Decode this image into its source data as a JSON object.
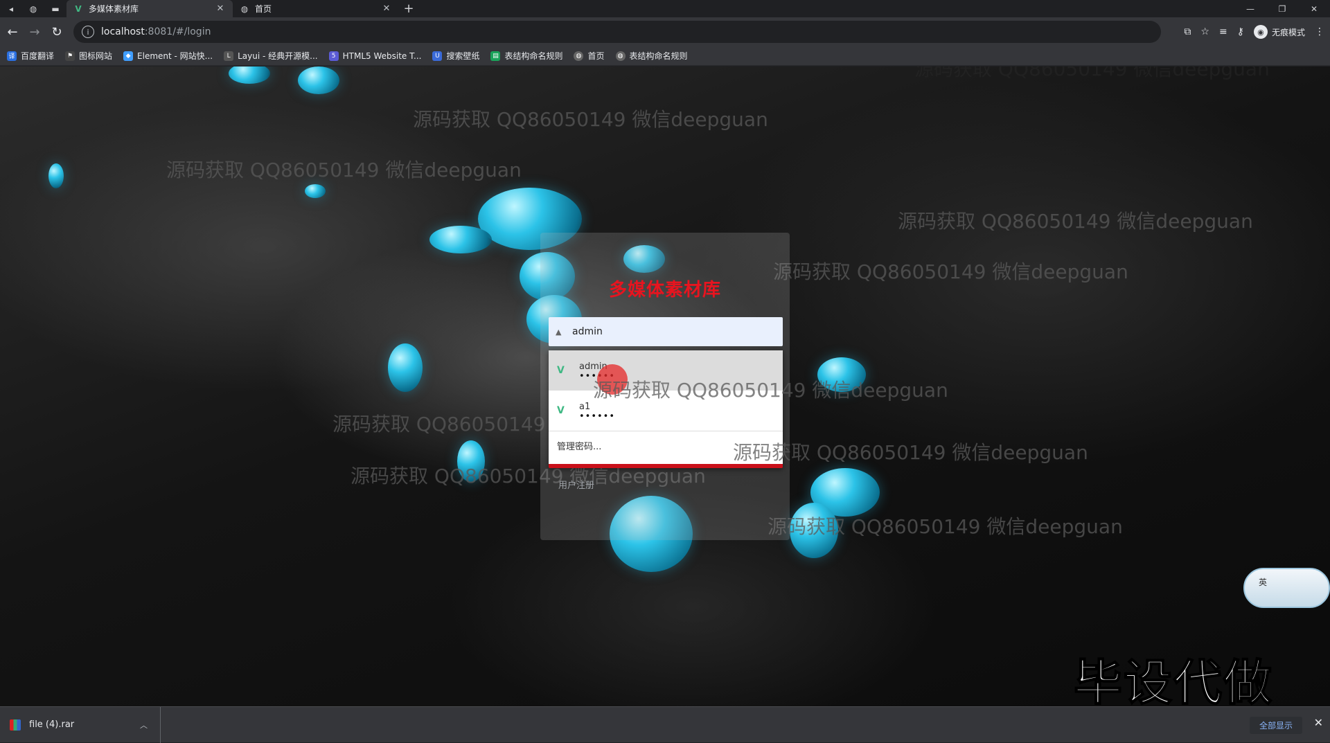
{
  "tabs": [
    {
      "title": "多媒体素材库",
      "active": true
    },
    {
      "title": "首页",
      "active": false
    }
  ],
  "address": {
    "host": "localhost",
    "path": ":8081/#/login"
  },
  "profile": {
    "label": "无痕模式"
  },
  "bookmarks": [
    {
      "label": "百度翻译",
      "color": "#2a6fe0"
    },
    {
      "label": "图标网站",
      "color": "#444444"
    },
    {
      "label": "Element - 网站快...",
      "color": "#409eff"
    },
    {
      "label": "Layui - 经典开源模...",
      "color": "#555555"
    },
    {
      "label": "HTML5 Website T...",
      "color": "#5b5bd6"
    },
    {
      "label": "搜索壁纸",
      "color": "#3a6ad8"
    },
    {
      "label": "表结构命名规则",
      "color": "#1aa35a"
    },
    {
      "label": "首页",
      "color": "#666666"
    },
    {
      "label": "表结构命名规则",
      "color": "#666666"
    }
  ],
  "login": {
    "title": "多媒体素材库",
    "username_value": "admin",
    "register_label": "用户注册"
  },
  "autofill": {
    "entries": [
      {
        "username": "admin",
        "password_mask": "••••••"
      },
      {
        "username": "a1",
        "password_mask": "••••••"
      }
    ],
    "manage_label": "管理密码..."
  },
  "watermark_text": "源码获取 QQ86050149 微信deepguan",
  "overlay_text": "毕设代做",
  "ime_label": "英",
  "download": {
    "file_name": "file (4).rar",
    "show_all": "全部显示"
  }
}
